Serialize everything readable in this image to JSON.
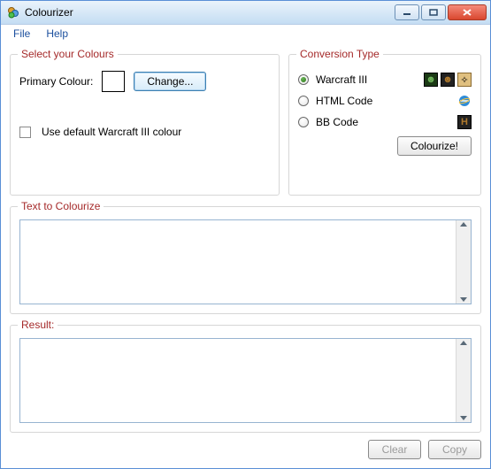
{
  "window": {
    "title": "Colourizer"
  },
  "menu": {
    "file": "File",
    "help": "Help"
  },
  "colours": {
    "legend": "Select your Colours",
    "primary_label": "Primary Colour:",
    "change_btn": "Change...",
    "default_check": "Use default Warcraft III colour"
  },
  "conversion": {
    "legend": "Conversion Type",
    "options": [
      {
        "label": "Warcraft III",
        "checked": true
      },
      {
        "label": "HTML Code",
        "checked": false
      },
      {
        "label": "BB Code",
        "checked": false
      }
    ],
    "colourize_btn": "Colourize!"
  },
  "text_box": {
    "legend": "Text to Colourize"
  },
  "result_box": {
    "legend": "Result:"
  },
  "buttons": {
    "clear": "Clear",
    "copy": "Copy"
  }
}
